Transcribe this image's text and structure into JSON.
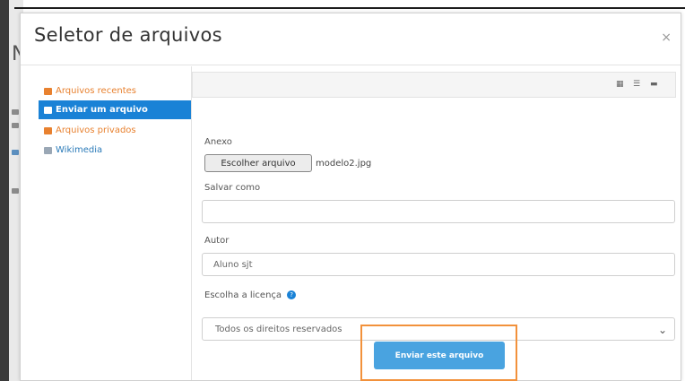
{
  "dialog": {
    "title": "Seletor de arquivos",
    "close_icon": "×"
  },
  "background": {
    "letter": "N"
  },
  "sidebar": {
    "items": [
      {
        "label": "Arquivos recentes",
        "icon": "recent-files-icon",
        "active": false
      },
      {
        "label": "Enviar um arquivo",
        "icon": "upload-icon",
        "active": true
      },
      {
        "label": "Arquivos privados",
        "icon": "private-files-icon",
        "active": false
      },
      {
        "label": "Wikimedia",
        "icon": "wikimedia-icon",
        "active": false
      }
    ]
  },
  "toolbar": {
    "views": [
      "grid-view-icon",
      "list-view-icon",
      "tree-view-icon"
    ]
  },
  "form": {
    "attachment_label": "Anexo",
    "choose_file_label": "Escolher arquivo",
    "file_name": "modelo2.jpg",
    "save_as_label": "Salvar como",
    "save_as_value": "",
    "author_label": "Autor",
    "author_value": "Aluno sjt",
    "license_label": "Escolha a licença",
    "license_value": "Todos os direitos reservados",
    "submit_label": "Enviar este arquivo"
  },
  "colors": {
    "accent": "#1a82d6",
    "submit": "#49a3e0",
    "highlight": "#f2913b",
    "sidebar_link": "#e8812f"
  }
}
